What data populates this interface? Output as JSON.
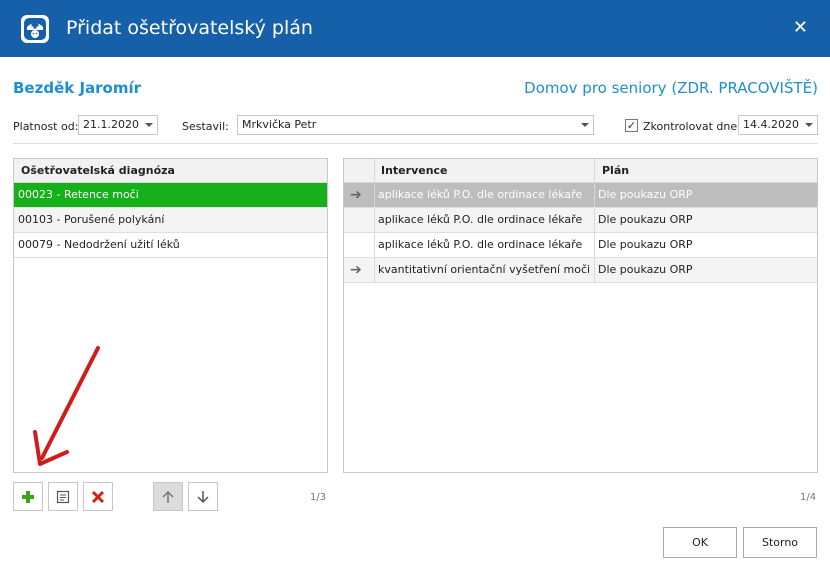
{
  "window": {
    "title": "Přidat ošetřovatelský plán",
    "close": "✕"
  },
  "header": {
    "patient": "Bezděk Jaromír",
    "facility": "Domov pro seniory (ZDR. PRACOVIŠTĚ)"
  },
  "filters": {
    "valid_from_label": "Platnost od:",
    "valid_from_value": "21.1.2020",
    "author_label": "Sestavil:",
    "author_value": "Mrkvička Petr",
    "check_label": "Zkontrolovat dne:",
    "check_checked": true,
    "check_value": "14.4.2020"
  },
  "diagnoses": {
    "header": "Ošetřovatelská diagnóza",
    "rows": [
      {
        "text": "00023 - Retence moči",
        "selected": true
      },
      {
        "text": "00103 - Porušené polykání"
      },
      {
        "text": "00079 - Nedodržení užití léků"
      }
    ],
    "count": "1/3"
  },
  "interventions": {
    "headers": {
      "intervention": "Intervence",
      "plan": "Plán"
    },
    "rows": [
      {
        "arrow": true,
        "intervention": "aplikace léků P.O. dle ordinace lékaře",
        "plan": "Dle poukazu ORP",
        "highlight": true
      },
      {
        "arrow": false,
        "intervention": "aplikace léků P.O. dle ordinace lékaře",
        "plan": "Dle poukazu ORP"
      },
      {
        "arrow": false,
        "intervention": "aplikace léků P.O. dle ordinace lékaře",
        "plan": "Dle poukazu ORP"
      },
      {
        "arrow": true,
        "intervention": "kvantitativní orientační vyšetření moči",
        "plan": "Dle poukazu ORP"
      }
    ],
    "count": "1/4"
  },
  "buttons": {
    "ok": "OK",
    "cancel": "Storno"
  },
  "colors": {
    "titlebar": "#1660a9",
    "accent": "#1f8fd0",
    "selected_row": "#15b01a",
    "add_icon": "#3aa51b",
    "delete_icon": "#d0231d"
  },
  "icons": [
    "nurse-icon",
    "close-icon",
    "add-icon",
    "edit-icon",
    "delete-icon",
    "arrow-up-icon",
    "arrow-down-icon",
    "row-arrow-icon"
  ]
}
